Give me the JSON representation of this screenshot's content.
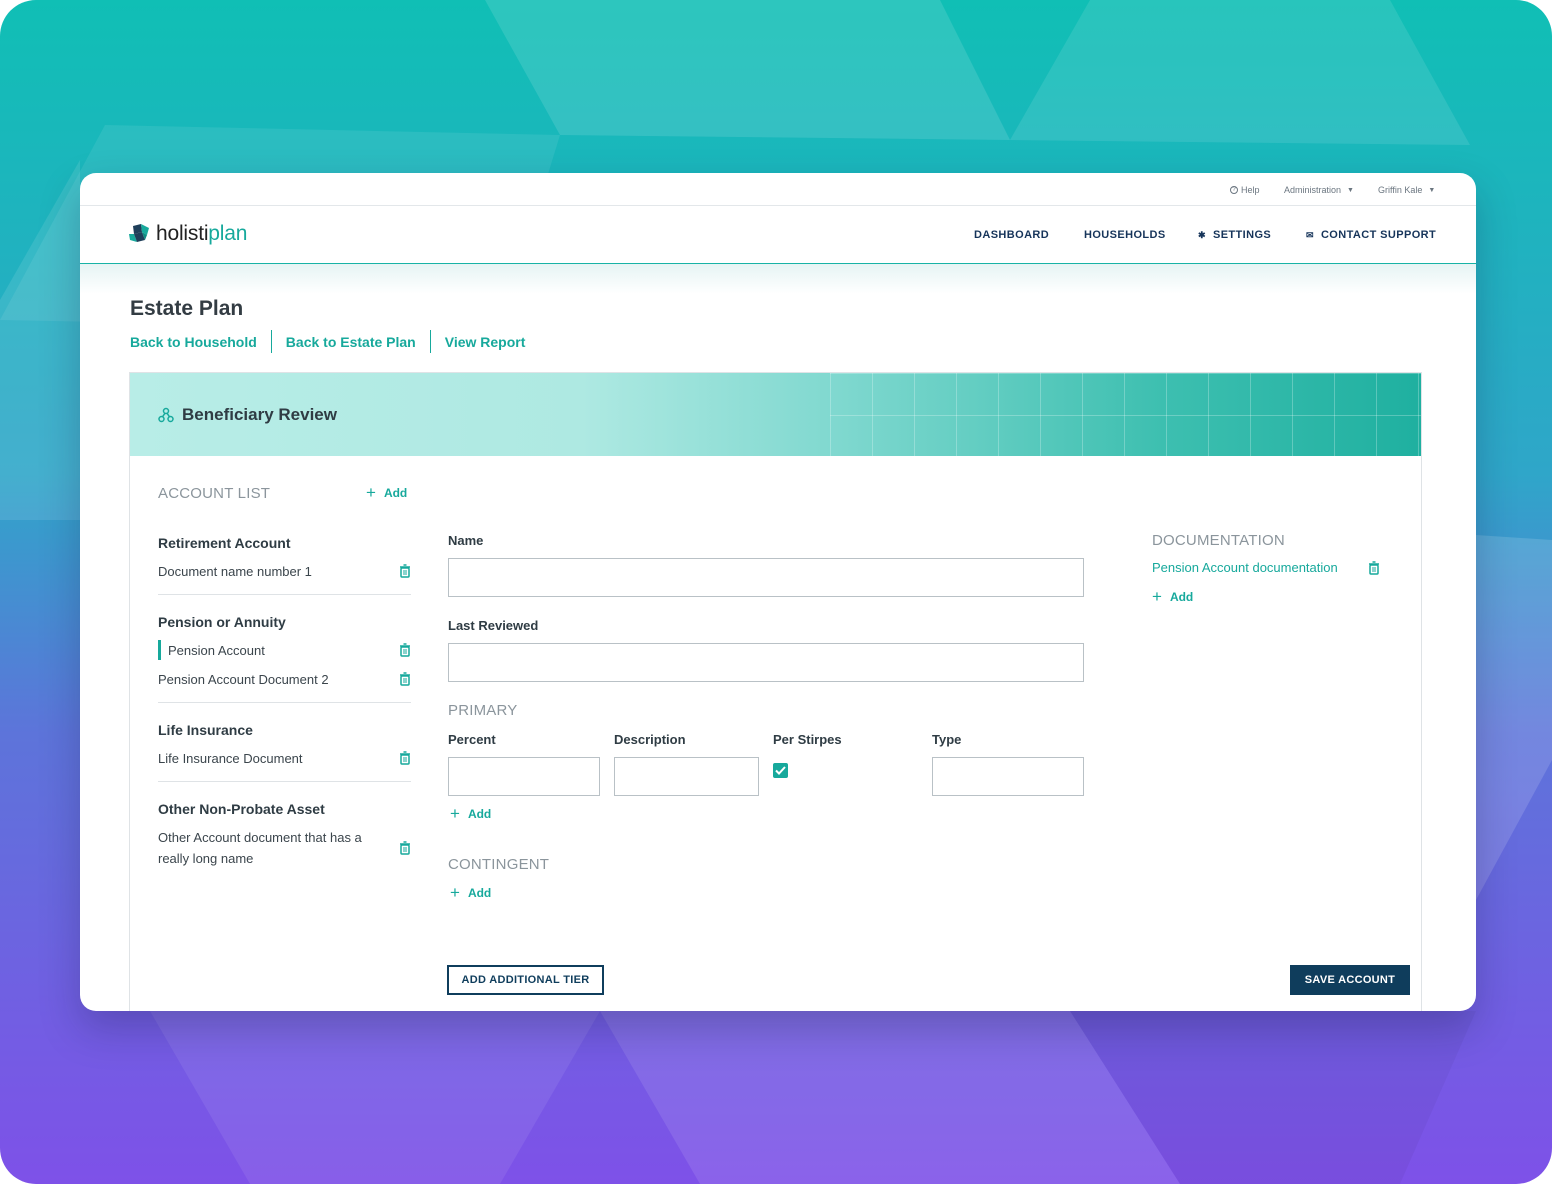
{
  "colors": {
    "accent": "#17a99c",
    "navy": "#0f3d5c",
    "text": "#2f3c44",
    "muted": "#8b959c"
  },
  "utility_bar": {
    "help": "Help",
    "administration": "Administration",
    "user": "Griffin Kale"
  },
  "brand": {
    "prefix": "holisti",
    "suffix": "plan"
  },
  "nav": {
    "dashboard": "DASHBOARD",
    "households": "HOUSEHOLDS",
    "settings": "SETTINGS",
    "contact": "CONTACT SUPPORT"
  },
  "page": {
    "title": "Estate Plan",
    "breadcrumbs": [
      "Back to Household",
      "Back to Estate Plan",
      "View Report"
    ]
  },
  "card": {
    "title": "Beneficiary Review"
  },
  "account_list": {
    "label": "ACCOUNT LIST",
    "add": "Add",
    "groups": [
      {
        "title": "Retirement Account",
        "docs": [
          "Document name number 1"
        ]
      },
      {
        "title": "Pension or Annuity",
        "docs": [
          "Pension Account",
          "Pension Account Document 2"
        ],
        "active_doc": "Pension Account"
      },
      {
        "title": "Life Insurance",
        "docs": [
          "Life Insurance Document"
        ]
      },
      {
        "title": "Other Non-Probate Asset",
        "docs": [
          "Other Account document that has a really long name"
        ]
      }
    ]
  },
  "form": {
    "name_label": "Name",
    "name_value": "",
    "last_reviewed_label": "Last Reviewed",
    "last_reviewed_value": "",
    "primary_label": "PRIMARY",
    "columns": {
      "percent": "Percent",
      "description": "Description",
      "per_stirpes": "Per Stirpes",
      "type": "Type"
    },
    "per_stirpes_checked": true,
    "primary_add": "Add",
    "contingent_label": "CONTINGENT",
    "contingent_add": "Add"
  },
  "documentation": {
    "label": "DOCUMENTATION",
    "items": [
      "Pension Account documentation"
    ],
    "add": "Add"
  },
  "buttons": {
    "add_tier": "ADD ADDITIONAL TIER",
    "save": "SAVE ACCOUNT"
  }
}
